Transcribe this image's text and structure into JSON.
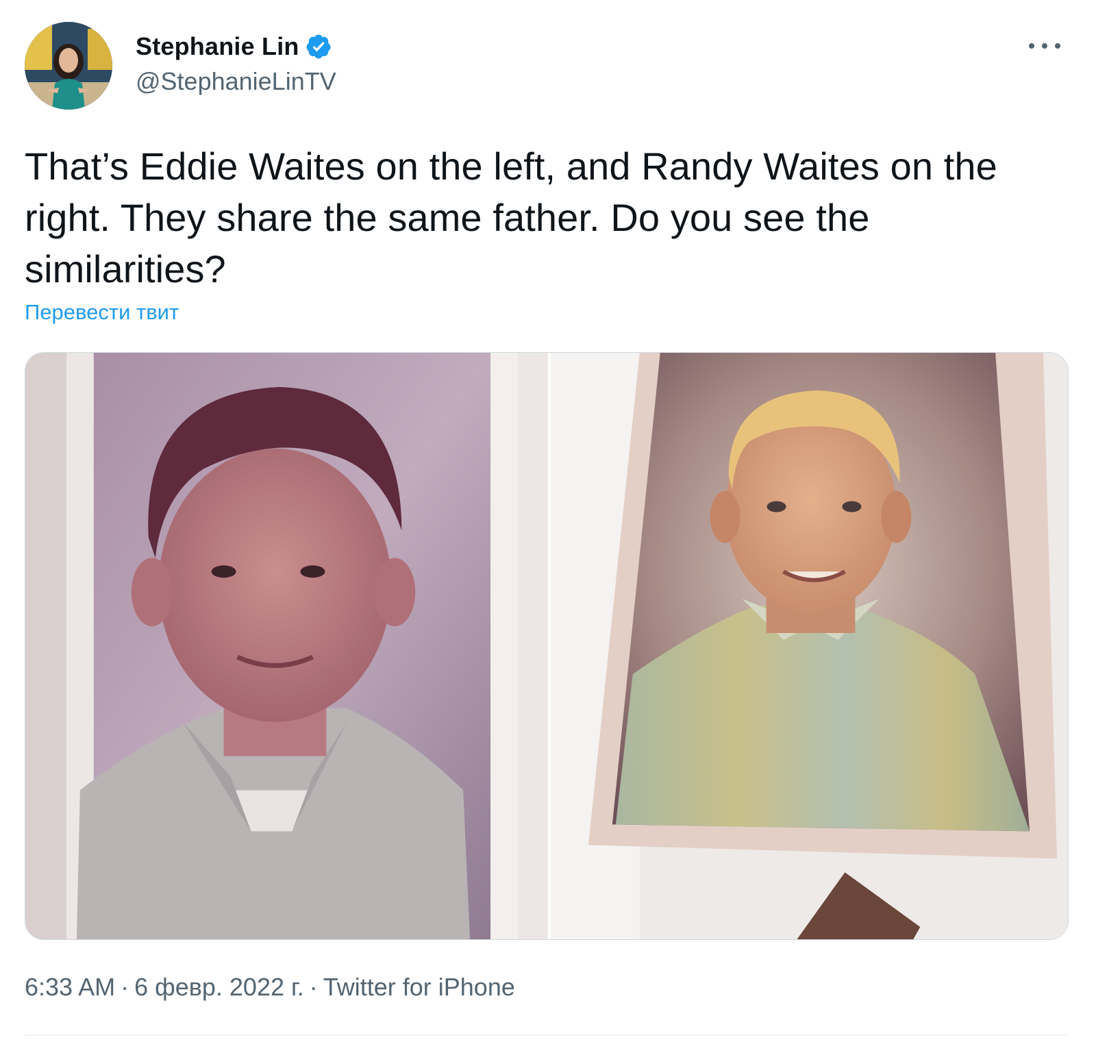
{
  "author": {
    "display_name": "Stephanie Lin",
    "handle": "@StephanieLinTV",
    "verified": true,
    "avatar_icon": "profile-photo"
  },
  "menu": {
    "icon": "more-horizontal-icon"
  },
  "tweet": {
    "text": "That’s Eddie Waites on the left, and Randy Waites on the right. They share the same father. Do you see the similarities?",
    "translate_label": "Перевести твит"
  },
  "media": {
    "photos": [
      {
        "description_icon": "school-portrait-photo"
      },
      {
        "description_icon": "school-portrait-photo"
      }
    ]
  },
  "meta": {
    "time": "6:33 AM",
    "date": "6 февр. 2022 г.",
    "source": "Twitter for iPhone",
    "separator": "·"
  },
  "colors": {
    "accent": "#1d9bf0",
    "text_primary": "#0f1419",
    "text_secondary": "#536471"
  }
}
